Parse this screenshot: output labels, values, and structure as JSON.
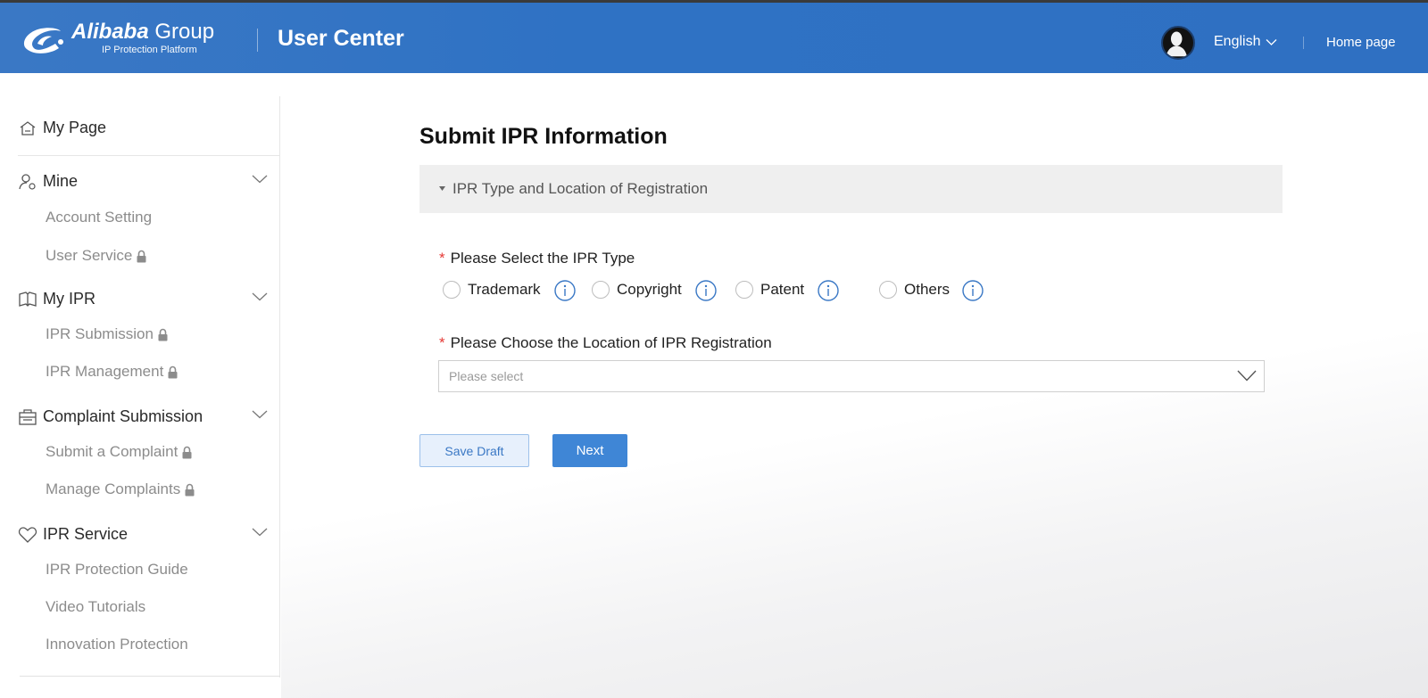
{
  "header": {
    "logo_brand": "Alibaba",
    "logo_group": "Group",
    "logo_subtitle": "IP Protection Platform",
    "title": "User Center",
    "language": "English",
    "home_link": "Home page",
    "color": "#2f72c4"
  },
  "sidebar": {
    "my_page": "My Page",
    "sections": [
      {
        "label": "Mine",
        "icon": "user-gear-icon",
        "items": [
          {
            "label": "Account Setting",
            "locked": false
          },
          {
            "label": "User Service",
            "locked": true
          }
        ]
      },
      {
        "label": "My IPR",
        "icon": "book-icon",
        "items": [
          {
            "label": "IPR Submission",
            "locked": true
          },
          {
            "label": "IPR Management",
            "locked": true
          }
        ]
      },
      {
        "label": "Complaint Submission",
        "icon": "briefcase-icon",
        "items": [
          {
            "label": "Submit a Complaint",
            "locked": true
          },
          {
            "label": "Manage Complaints",
            "locked": true
          }
        ]
      },
      {
        "label": "IPR Service",
        "icon": "heart-icon",
        "items": [
          {
            "label": "IPR Protection Guide",
            "locked": false
          },
          {
            "label": "Video Tutorials",
            "locked": false
          },
          {
            "label": "Innovation Protection",
            "locked": false
          }
        ]
      }
    ]
  },
  "main": {
    "page_title": "Submit IPR Information",
    "section_title": "IPR Type and Location of Registration",
    "ipr_type_label": "Please Select the IPR Type",
    "ipr_types": [
      "Trademark",
      "Copyright",
      "Patent",
      "Others"
    ],
    "location_label": "Please Choose the Location of IPR Registration",
    "location_placeholder": "Please select",
    "save_draft": "Save Draft",
    "next": "Next",
    "required_mark": "*"
  }
}
